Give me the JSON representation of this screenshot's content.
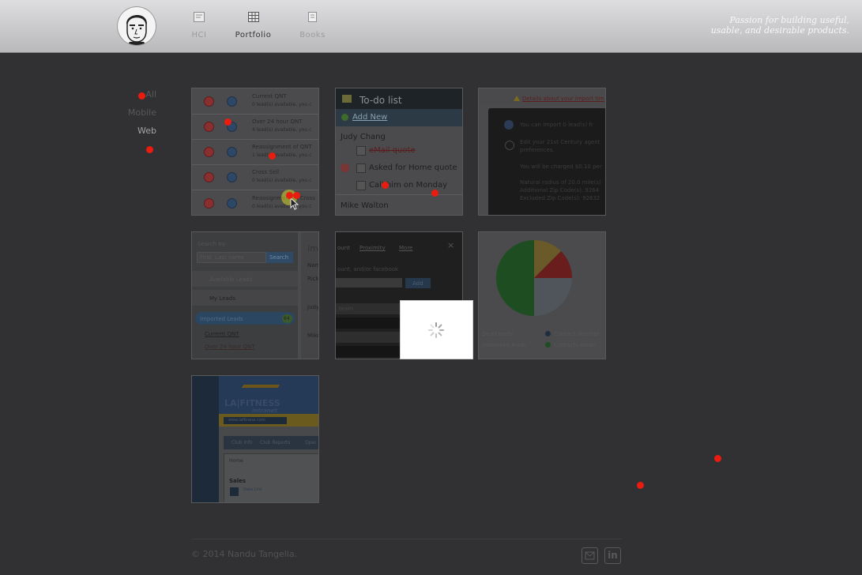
{
  "header": {
    "nav": [
      {
        "label": "HCI",
        "icon": "hci-icon"
      },
      {
        "label": "Portfolio",
        "icon": "grid-icon"
      },
      {
        "label": "Books",
        "icon": "book-icon"
      }
    ],
    "tagline_line1": "Passion for building useful,",
    "tagline_line2": "usable, and desirable products."
  },
  "filter": [
    "All",
    "Mobile",
    "Web"
  ],
  "tiles": {
    "queue": {
      "rows": [
        {
          "title": "Current QNT",
          "sub": "0 lead(s) available, you c"
        },
        {
          "title": "Over 24 hour QNT",
          "sub": "4 lead(s) available, you c"
        },
        {
          "title": "Reassignment of QNT",
          "sub": "1 lead(s) available, you c"
        },
        {
          "title": "Cross Sell",
          "sub": "0 lead(s) available, you c"
        },
        {
          "title": "Reassignment of Cross",
          "sub": "0 lead(s) available, you c"
        }
      ]
    },
    "todo": {
      "title": "To-do list",
      "add": "Add New",
      "person1": "Judy Chang",
      "items": [
        "eMail quote",
        "Asked for Home quote",
        "Call him on Monday"
      ],
      "person2": "Mike Walton"
    },
    "import": {
      "link": "Details about your import tim",
      "lines": [
        "You can import 0 lead(s) fr",
        "Edit your 21st Century agent",
        "preferences.",
        "You will be charged $0.10 per",
        "Natural radius of 20.0 mile(s)",
        "Additional Zip Code(s): 9264",
        "Excluded Zip Code(s): 92632"
      ]
    },
    "search": {
      "label": "Search by:",
      "placeholder": "First, Last name",
      "button": "Search",
      "menu": [
        "Available Leads",
        "My Leads",
        "Imported Leads",
        "Current QNT",
        "Over 24 hour QNT"
      ],
      "badge": "64",
      "side_header": "Im",
      "side_col": "Nam",
      "side_names": [
        "Rick",
        "Judy",
        "Mike"
      ]
    },
    "social": {
      "tabs": [
        "ount",
        "Proximity",
        "More"
      ],
      "hint": "ount, and/or facebook",
      "add": "Add",
      "row": "team"
    },
    "pie": {
      "legend": [
        "Dead leads",
        "Unworked leads",
        "Contact attempt",
        "Contacts made"
      ]
    },
    "lafitness": {
      "logo": "LA|FITNESS",
      "sub": "intranet",
      "search": "www.lafitness.com",
      "tabs": [
        "Club Info",
        "Club Reports",
        "Oper"
      ],
      "home": "Home",
      "sales": "Sales",
      "link": "Data Link"
    }
  },
  "footer": {
    "copyright": "© 2014 Nandu Tangella.",
    "social": [
      "contact-icon",
      "linkedin-icon"
    ],
    "linkedin_text": "in"
  },
  "colors": {
    "header": "#cdcdcf",
    "overlay_bg": "#313133",
    "dot": "#ea1c0f"
  }
}
